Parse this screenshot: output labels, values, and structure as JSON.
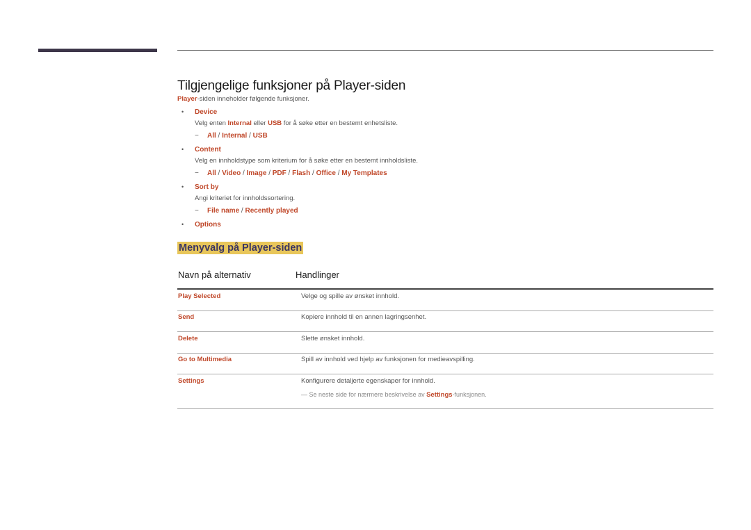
{
  "page": {
    "title": "Tilgjengelige funksjoner på Player-siden",
    "intro": {
      "highlight": "Player",
      "rest": "-siden inneholder følgende funksjoner."
    },
    "bullets": [
      {
        "label": "Device",
        "description": {
          "parts": [
            "Velg enten ",
            "Internal",
            " eller ",
            "USB",
            " for å søke etter en bestemt enhetsliste."
          ]
        },
        "options": [
          "All",
          "Internal",
          "USB"
        ]
      },
      {
        "label": "Content",
        "description": {
          "parts": [
            "Velg en innholdstype som kriterium for å søke etter en bestemt innholdsliste."
          ]
        },
        "options": [
          "All",
          "Video",
          "Image",
          "PDF",
          "Flash",
          "Office",
          "My Templates"
        ]
      },
      {
        "label": "Sort by",
        "description": {
          "parts": [
            "Angi kriteriet for innholdssortering."
          ]
        },
        "options": [
          "File name",
          "Recently played"
        ]
      },
      {
        "label": "Options"
      }
    ],
    "bullet_glyph": "•",
    "dash_glyph": "−",
    "separator": " / "
  },
  "menu_section": {
    "heading": "Menyvalg på Player-siden",
    "table": {
      "headers": [
        "Navn på alternativ",
        "Handlinger"
      ],
      "rows": [
        {
          "name": "Play Selected",
          "action": "Velge og spille av ønsket innhold."
        },
        {
          "name": "Send",
          "action": "Kopiere innhold til en annen lagringsenhet."
        },
        {
          "name": "Delete",
          "action": "Slette ønsket innhold."
        },
        {
          "name": "Go to Multimedia",
          "action": "Spill av innhold ved hjelp av funksjonen for medieavspilling."
        },
        {
          "name": "Settings",
          "action": "Konfigurere detaljerte egenskaper for innhold.",
          "note": {
            "prefix": "— Se neste side for nærmere beskrivelse av ",
            "highlight": "Settings",
            "suffix": "-funksjonen."
          }
        }
      ]
    }
  },
  "colors": {
    "accent": "#c0482a",
    "heading_highlight": "#e8c65a",
    "heading_text": "#3a3561",
    "left_bar": "#3d3649"
  }
}
